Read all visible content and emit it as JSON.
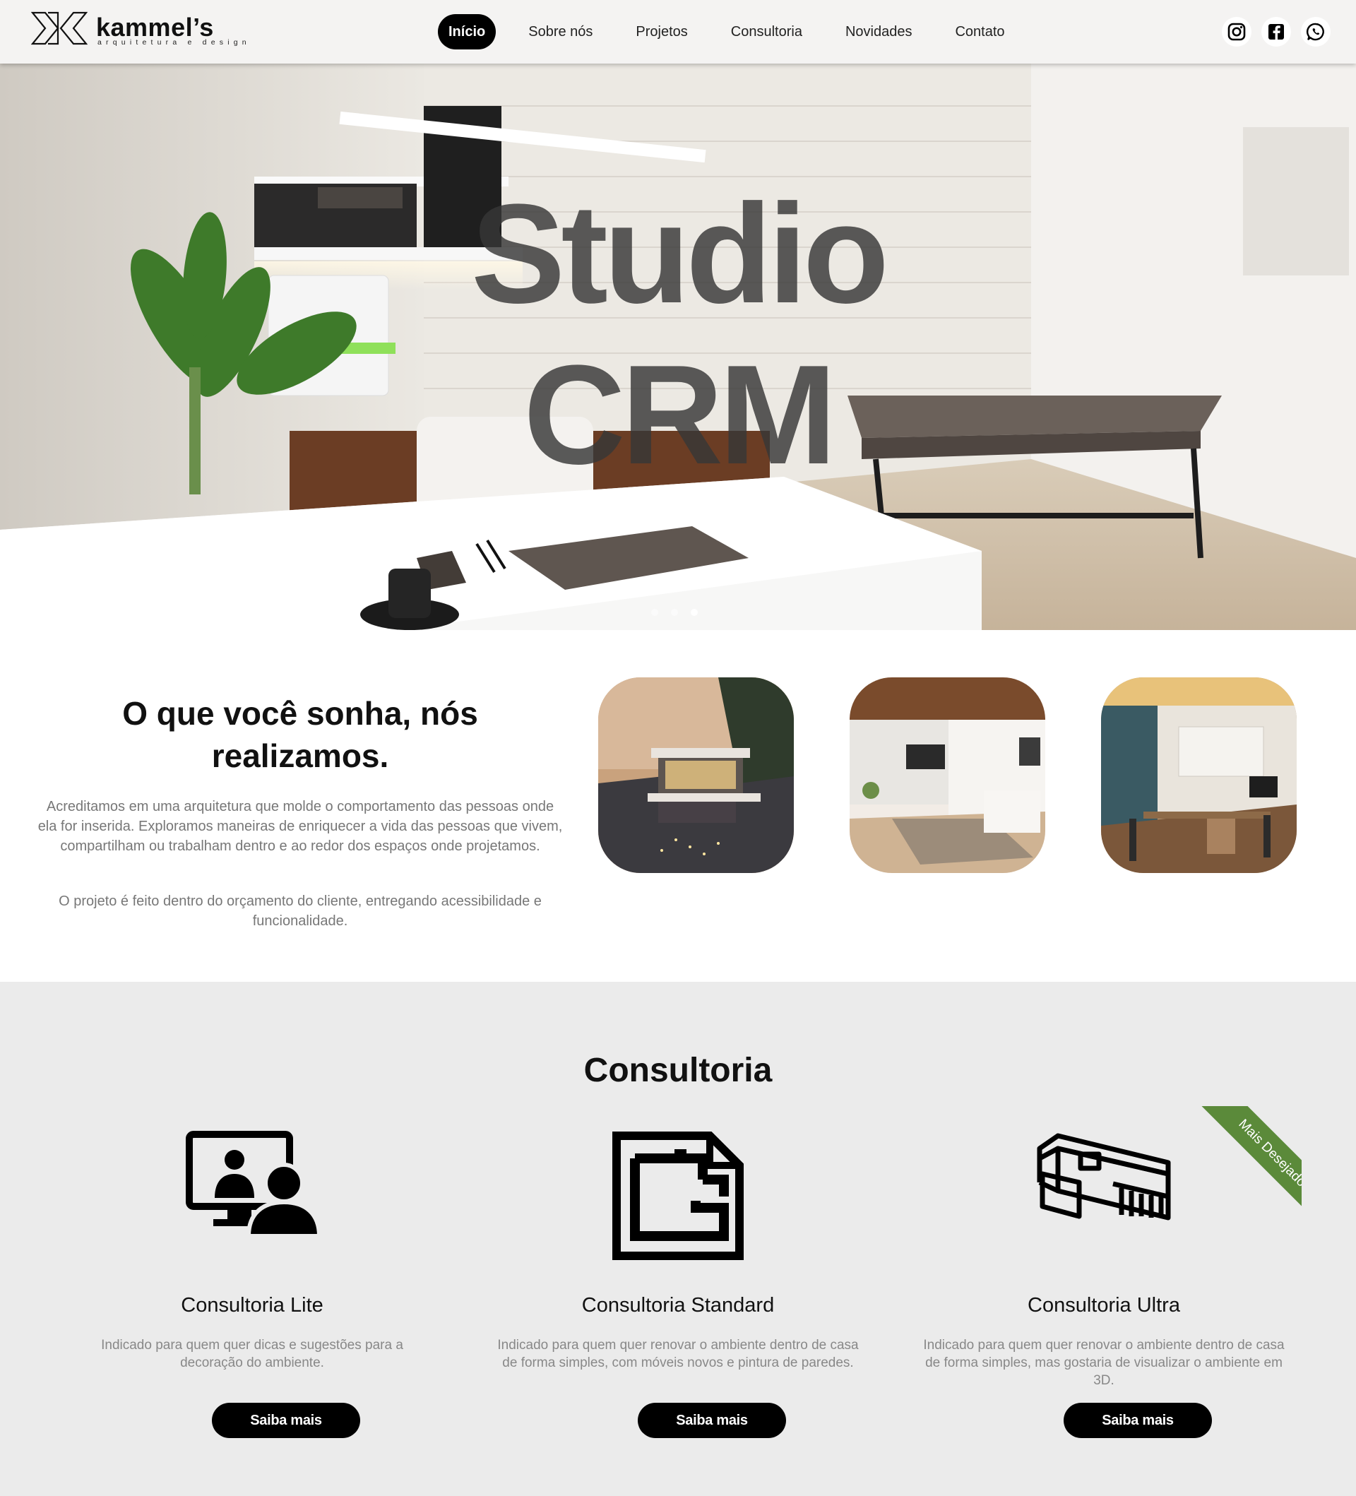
{
  "brand": {
    "name": "kammel’s",
    "tagline": "arquitetura e design"
  },
  "nav": {
    "items": [
      {
        "label": "Início",
        "active": true
      },
      {
        "label": "Sobre nós",
        "active": false
      },
      {
        "label": "Projetos",
        "active": false
      },
      {
        "label": "Consultoria",
        "active": false
      },
      {
        "label": "Novidades",
        "active": false
      },
      {
        "label": "Contato",
        "active": false
      }
    ]
  },
  "social": [
    "instagram-icon",
    "facebook-icon",
    "whatsapp-icon"
  ],
  "hero": {
    "line1": "Studio",
    "line2": "CRM",
    "slides": 3,
    "active_slide": 3
  },
  "intro": {
    "heading": "O que você sonha, nós realizamos.",
    "paragraph1": "Acreditamos em uma arquitetura que molde o comportamento das pessoas onde ela for inserida. Exploramos maneiras de enriquecer a vida das pessoas que vivem, compartilham ou trabalham dentro e ao redor dos espaços onde projetamos.",
    "paragraph2": "O projeto é feito dentro do orçamento do cliente, entregando acessibilidade e funcionalidade."
  },
  "consultoria": {
    "title": "Consultoria",
    "cards": [
      {
        "icon": "video-call-icon",
        "title": "Consultoria Lite",
        "description": "Indicado para quem quer dicas e sugestões para a decoração do ambiente.",
        "button": "Saiba mais"
      },
      {
        "icon": "floor-plan-icon",
        "title": "Consultoria Standard",
        "description": "Indicado para quem quer renovar o ambiente dentro de casa de forma simples, com móveis novos e pintura de paredes.",
        "button": "Saiba mais"
      },
      {
        "icon": "house-3d-icon",
        "title": "Consultoria Ultra",
        "description": "Indicado para quem quer renovar o ambiente dentro de casa de forma simples, mas gostaria de visualizar o ambiente em 3D.",
        "button": "Saiba mais",
        "ribbon": "Mais Desejado"
      }
    ]
  },
  "colors": {
    "accent": "#000000",
    "ribbon": "#5b8a3a",
    "section_bg": "#ebebeb"
  }
}
